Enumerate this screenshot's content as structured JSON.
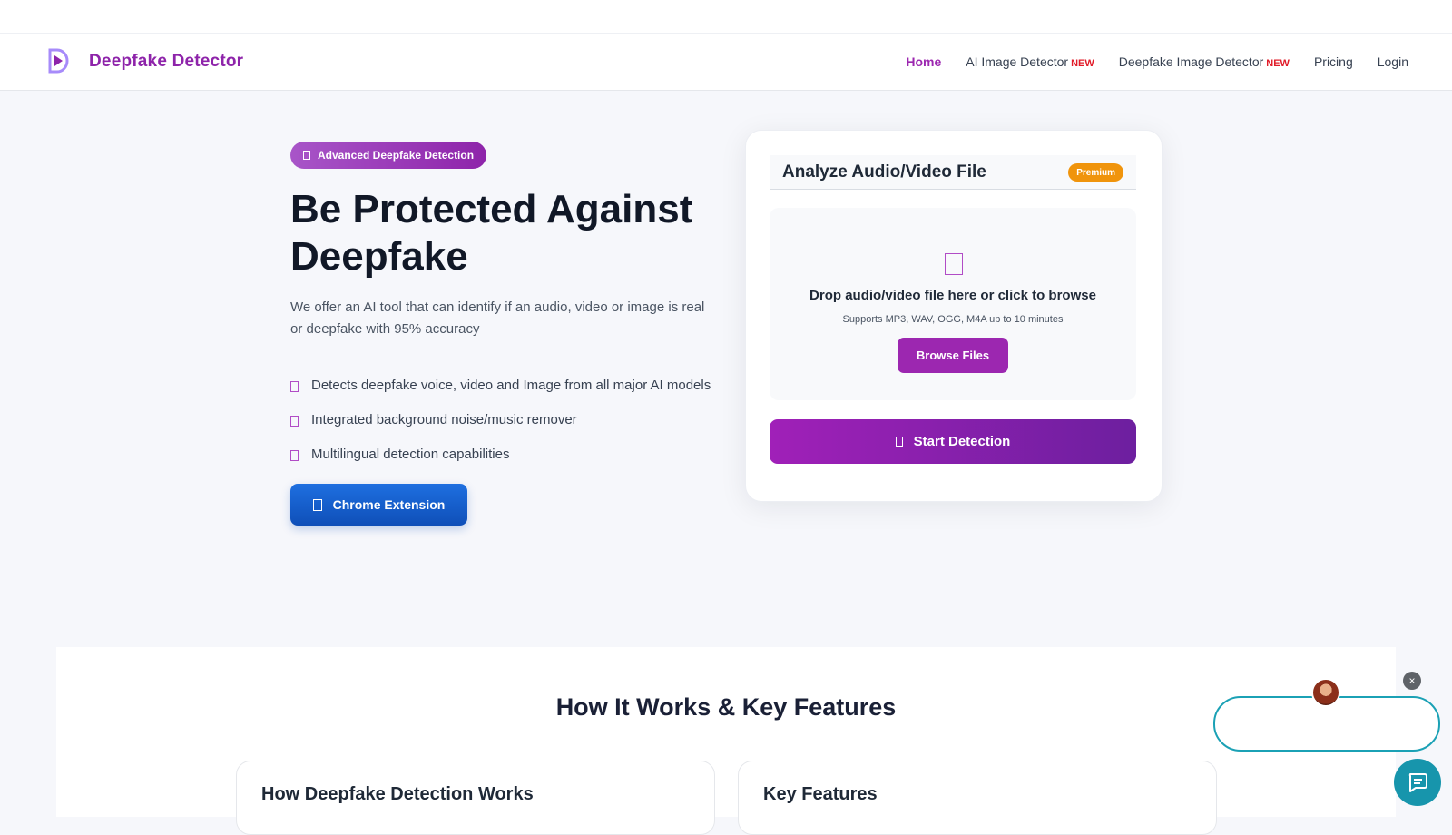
{
  "header": {
    "brand": "Deepfake Detector",
    "nav": [
      {
        "label": "Home",
        "active": true
      },
      {
        "label": "AI Image Detector",
        "badge": "NEW"
      },
      {
        "label": "Deepfake Image Detector",
        "badge": "NEW"
      },
      {
        "label": "Pricing"
      },
      {
        "label": "Login"
      }
    ]
  },
  "hero": {
    "badge": "Advanced Deepfake Detection",
    "title": "Be Protected Against Deepfake",
    "lead": "We offer an AI tool that can identify if an audio, video or image is real or deepfake with 95% accuracy",
    "features": [
      "Detects deepfake voice, video and Image from all major AI models",
      "Integrated background noise/music remover",
      "Multilingual detection capabilities"
    ],
    "chrome_button": "Chrome Extension"
  },
  "analyze_card": {
    "title": "Analyze Audio/Video File",
    "badge": "Premium",
    "drop_title": "Drop audio/video file here or click to browse",
    "drop_sub": "Supports MP3, WAV, OGG, M4A up to 10 minutes",
    "browse_label": "Browse Files",
    "start_label": "Start Detection"
  },
  "section": {
    "title": "How It Works & Key Features",
    "cards": [
      "How Deepfake Detection Works",
      "Key Features"
    ]
  },
  "chat": {
    "close_symbol": "×"
  },
  "colors": {
    "brand": "#8e24aa",
    "accent": "#9c27b0",
    "new_badge": "#e11d2a",
    "premium": "#f0940c",
    "chrome_button": "#1565d8",
    "chat": "#1795ac"
  },
  "icons": [
    "logo-icon",
    "shield-icon",
    "check-icon",
    "chrome-icon",
    "upload-icon",
    "search-icon",
    "close-icon",
    "chat-icon"
  ]
}
